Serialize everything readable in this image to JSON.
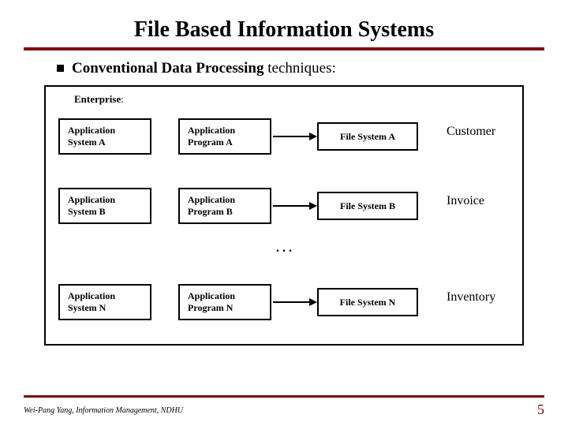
{
  "title": "File Based Information Systems",
  "subtitle_bold": "Conventional Data Processing",
  "subtitle_rest": " techniques:",
  "enterprise_label_bold": "Enterprise",
  "enterprise_label_rest": ":",
  "rows": [
    {
      "system": "Application System A",
      "program": "Application Program A",
      "file": "File System A",
      "entity": "Customer"
    },
    {
      "system": "Application System B",
      "program": "Application Program B",
      "file": "File  System B",
      "entity": "Invoice"
    },
    {
      "system": "Application System N",
      "program": "Application Program  N",
      "file": "File System N",
      "entity": "Inventory"
    }
  ],
  "ellipsis": ". . .",
  "footer": "Wei-Pang Yang, Information Management, NDHU",
  "page": "5"
}
